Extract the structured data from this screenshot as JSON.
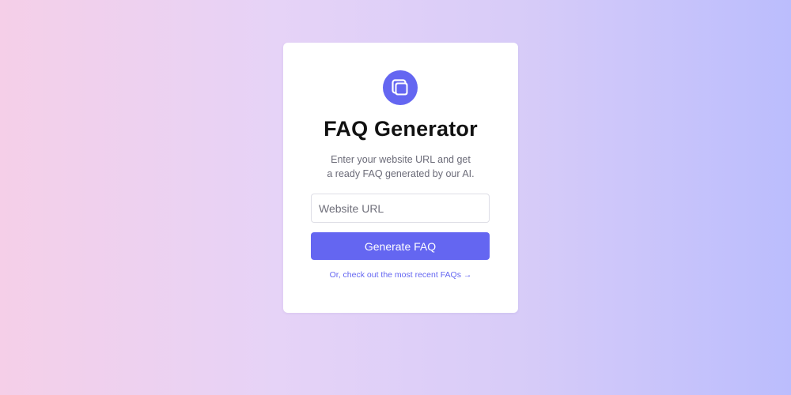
{
  "app": {
    "title": "FAQ Generator",
    "subtitle_line1": "Enter your website URL and get",
    "subtitle_line2": "a ready FAQ generated by our AI."
  },
  "form": {
    "url_placeholder": "Website URL",
    "url_value": "",
    "generate_label": "Generate FAQ"
  },
  "footer": {
    "recent_link_text": "Or, check out the most recent FAQs →"
  },
  "icons": {
    "logo": "stacked-squares-icon"
  },
  "colors": {
    "accent": "#6466f1",
    "link": "#6466f1",
    "card": "#ffffff",
    "title": "#111111",
    "subtitle": "#6b6b78"
  }
}
